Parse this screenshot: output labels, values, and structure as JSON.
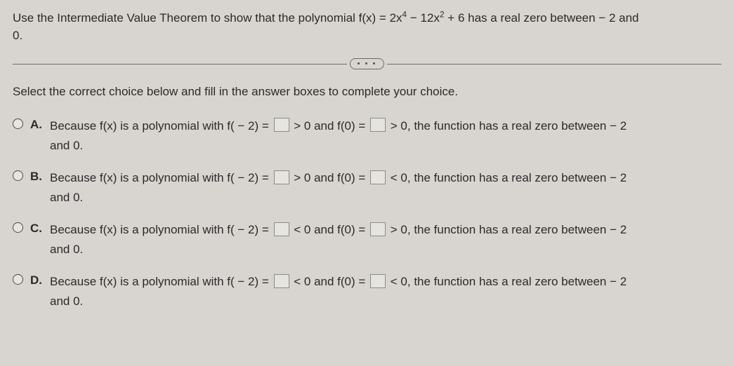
{
  "question": {
    "line1_pre": "Use the Intermediate Value Theorem to show that the polynomial f(x) = 2x",
    "exp1": "4",
    "mid1": " − 12x",
    "exp2": "2",
    "line1_post": " + 6 has a real zero between − 2 and",
    "line2": "0."
  },
  "pill": "• • •",
  "instruction": "Select the correct choice below and fill in the answer boxes to complete your choice.",
  "choices": [
    {
      "letter": "A.",
      "pre": "Because f(x) is a polynomial with f( − 2) = ",
      "cmp1": " > 0 and f(0) = ",
      "cmp2": " > 0, the function has a real zero between − 2",
      "tail": "and 0."
    },
    {
      "letter": "B.",
      "pre": "Because f(x) is a polynomial with f( − 2) = ",
      "cmp1": " > 0 and f(0) = ",
      "cmp2": " < 0, the function has a real zero between − 2",
      "tail": "and 0."
    },
    {
      "letter": "C.",
      "pre": "Because f(x) is a polynomial with f( − 2) = ",
      "cmp1": " < 0 and f(0) = ",
      "cmp2": " > 0, the function has a real zero between − 2",
      "tail": "and 0."
    },
    {
      "letter": "D.",
      "pre": "Because f(x) is a polynomial with f( − 2) = ",
      "cmp1": " < 0 and f(0) = ",
      "cmp2": " < 0, the function has a real zero between − 2",
      "tail": "and 0."
    }
  ]
}
